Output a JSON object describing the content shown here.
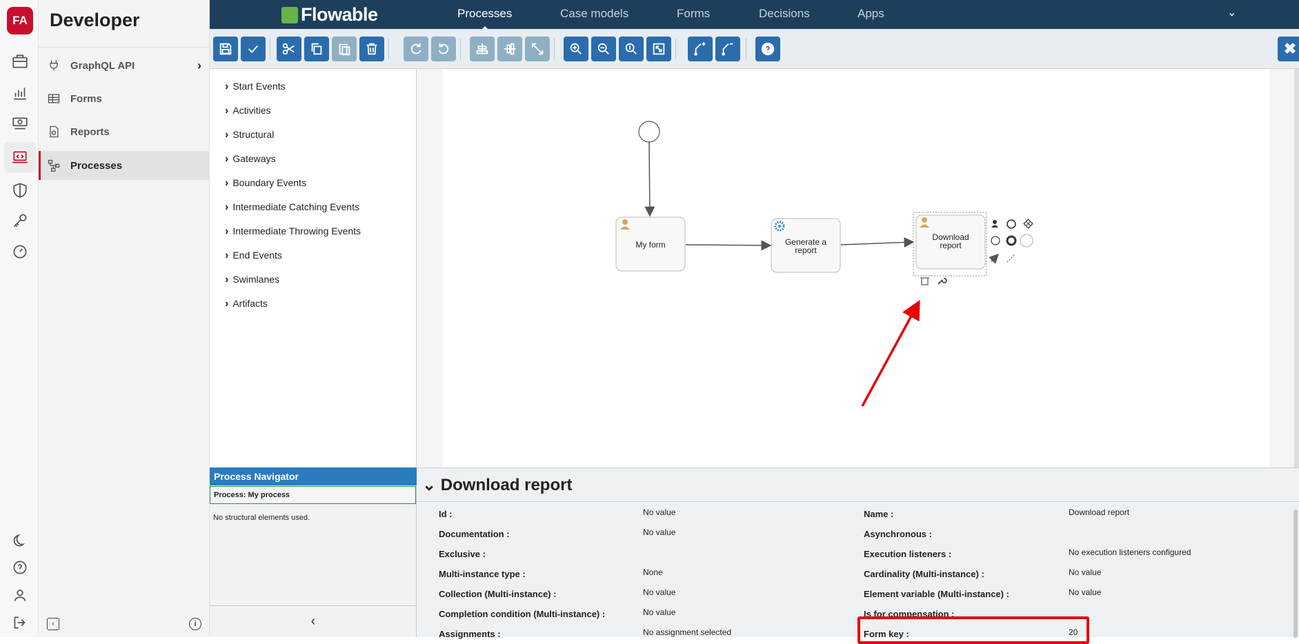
{
  "rail": {
    "logo": "FA",
    "icons": [
      "briefcase-icon",
      "analytics-icon",
      "money-icon",
      "developer-icon",
      "shield-icon",
      "key-icon",
      "dashboard-icon"
    ],
    "bottom_icons": [
      "moon-icon",
      "help-icon",
      "user-icon",
      "logout-icon"
    ]
  },
  "sidebar": {
    "title": "Developer",
    "items": [
      {
        "label": "GraphQL API",
        "icon": "plug-icon"
      },
      {
        "label": "Forms",
        "icon": "table-icon"
      },
      {
        "label": "Reports",
        "icon": "document-icon"
      },
      {
        "label": "Processes",
        "icon": "flow-icon"
      }
    ]
  },
  "topnav": {
    "brand": "Flowable",
    "links": [
      "Processes",
      "Case models",
      "Forms",
      "Decisions",
      "Apps"
    ],
    "active": "Processes",
    "dropdown": "⌄"
  },
  "toolbar": {
    "buttons": [
      "save-icon",
      "validate-icon",
      "cut-icon",
      "copy-icon",
      "paste-icon",
      "delete-icon",
      "redo-icon",
      "undo-icon",
      "align-horizontal-icon",
      "align-vertical-icon",
      "same-size-icon",
      "zoom-in-icon",
      "zoom-out-icon",
      "zoom-actual-icon",
      "zoom-fit-icon",
      "bendpoint-add-icon",
      "bendpoint-remove-icon",
      "help-icon"
    ],
    "close": "✖"
  },
  "palette": {
    "groups": [
      "Start Events",
      "Activities",
      "Structural",
      "Gateways",
      "Boundary Events",
      "Intermediate Catching Events",
      "Intermediate Throwing Events",
      "End Events",
      "Swimlanes",
      "Artifacts"
    ]
  },
  "diagram": {
    "tasks": [
      "My form",
      "Generate a",
      "report",
      "Download",
      "report"
    ]
  },
  "navigator": {
    "header": "Process Navigator",
    "process": "Process: My process",
    "empty": "No structural elements used.",
    "collapse": "‹"
  },
  "properties": {
    "title": "Download report",
    "left": [
      {
        "label": "Id :",
        "value": "No value"
      },
      {
        "label": "Documentation :",
        "value": "No value"
      },
      {
        "label": "Exclusive :",
        "value": ""
      },
      {
        "label": "Multi-instance type :",
        "value": "None"
      },
      {
        "label": "Collection (Multi-instance) :",
        "value": "No value"
      },
      {
        "label": "Completion condition (Multi-instance) :",
        "value": "No value"
      },
      {
        "label": "Assignments :",
        "value": "No assignment selected"
      }
    ],
    "right": [
      {
        "label": "Name :",
        "value": "Download report"
      },
      {
        "label": "Asynchronous :",
        "value": ""
      },
      {
        "label": "Execution listeners :",
        "value": "No execution listeners configured"
      },
      {
        "label": "Cardinality (Multi-instance) :",
        "value": "No value"
      },
      {
        "label": "Element variable (Multi-instance) :",
        "value": "No value"
      },
      {
        "label": "Is for compensation :",
        "value": ""
      },
      {
        "label": "Form key :",
        "value": "20"
      }
    ]
  },
  "colors": {
    "brand_red": "#c8102e",
    "nav_bg": "#1d3f5c",
    "button_blue": "#2b6cad",
    "highlight": "#e8000b"
  }
}
